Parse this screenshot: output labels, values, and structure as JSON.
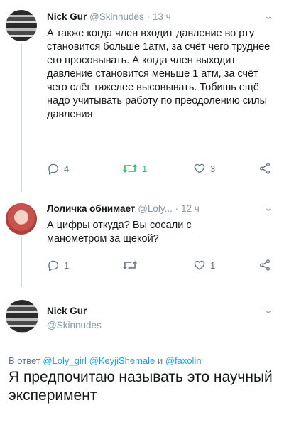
{
  "tweets": [
    {
      "name": "Nick Gur",
      "handle": "@Skinnudes",
      "sep": "·",
      "time": "13 ч",
      "text": "А также когда член входит давление во рту становится больше 1атм, за счёт чего труднее его просовывать. А когда член выходит давление становится меньше 1 атм, за счёт чего слёг тяжелее высовывать. Тобишь ещё надо учитывать работу по преодолению силы давления",
      "reply_count": "4",
      "retweet_count": "1",
      "like_count": "3"
    },
    {
      "name": "Лоличка обнимает",
      "handle": "@Loly...",
      "sep": "·",
      "time": "12 ч",
      "text": "А цифры откуда? Вы сосали с манометром за щекой?",
      "reply_count": "1",
      "retweet_count": "",
      "like_count": "1"
    }
  ],
  "main_tweet": {
    "name": "Nick Gur",
    "handle": "@Skinnudes",
    "reply_prefix": "В ответ",
    "reply_users": [
      "@Loly_girl",
      "@KeyjiShemale",
      "@faxolin"
    ],
    "reply_and": "и",
    "text": "Я предпочитаю называть это научный эксперимент"
  },
  "colors": {
    "accent": "#1da1f2",
    "retweet_active": "#17bf63",
    "muted": "#657786"
  }
}
